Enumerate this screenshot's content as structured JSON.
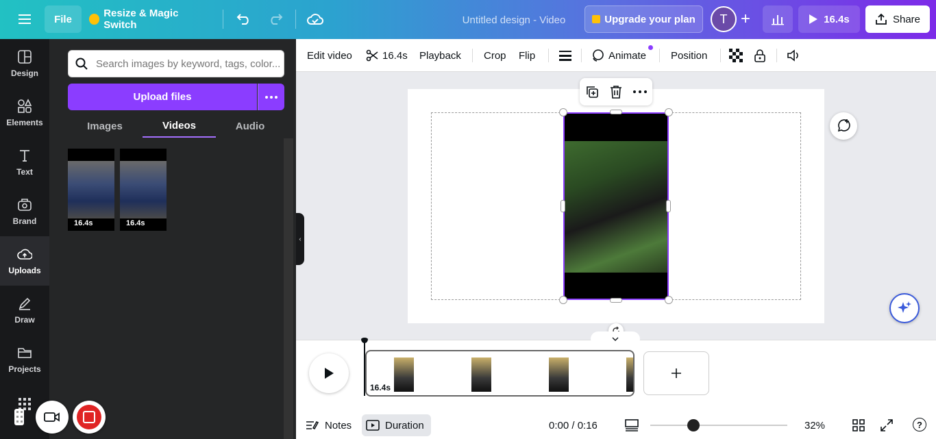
{
  "topbar": {
    "file_label": "File",
    "resize_label": "Resize & Magic Switch",
    "doc_title": "Untitled design - Video",
    "upgrade_label": "Upgrade your plan",
    "avatar_initial": "T",
    "play_duration": "16.4s",
    "share_label": "Share"
  },
  "sidebar": {
    "items": [
      {
        "label": "Design",
        "icon": "layout-icon"
      },
      {
        "label": "Elements",
        "icon": "shapes-icon"
      },
      {
        "label": "Text",
        "icon": "text-icon"
      },
      {
        "label": "Brand",
        "icon": "brand-icon"
      },
      {
        "label": "Uploads",
        "icon": "cloud-upload-icon"
      },
      {
        "label": "Draw",
        "icon": "pen-icon"
      },
      {
        "label": "Projects",
        "icon": "folder-icon"
      }
    ]
  },
  "panel": {
    "search_placeholder": "Search images by keyword, tags, color...",
    "upload_label": "Upload files",
    "tabs": [
      "Images",
      "Videos",
      "Audio"
    ],
    "active_tab": "Videos",
    "thumbs": [
      {
        "duration": "16.4s"
      },
      {
        "duration": "16.4s"
      }
    ]
  },
  "toolbar": {
    "edit_video": "Edit video",
    "trim_duration": "16.4s",
    "playback": "Playback",
    "crop": "Crop",
    "flip": "Flip",
    "animate": "Animate",
    "position": "Position"
  },
  "timeline": {
    "clip_duration": "16.4s",
    "notes_label": "Notes",
    "duration_label": "Duration",
    "time_readout": "0:00 / 0:16",
    "zoom": "32%"
  },
  "colors": {
    "accent": "#8b3dff"
  }
}
